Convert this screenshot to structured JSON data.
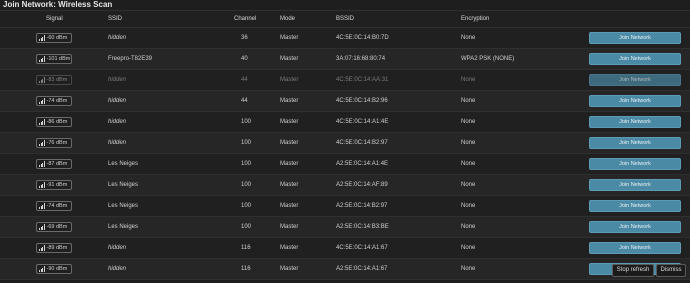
{
  "title": "Join Network: Wireless Scan",
  "columns": {
    "signal": "Signal",
    "ssid": "SSID",
    "channel": "Channel",
    "mode": "Mode",
    "bssid": "BSSID",
    "encryption": "Encryption"
  },
  "rows": [
    {
      "signal": "-60 dBm",
      "ssid": "hidden",
      "ssid_hidden": true,
      "channel": "36",
      "mode": "Master",
      "bssid": "4C:5E:0C:14:B0:7D",
      "encryption": "None",
      "join": "Join Network",
      "dimmed": false
    },
    {
      "signal": "-101 dBm",
      "ssid": "Freepro-T82E39",
      "ssid_hidden": false,
      "channel": "40",
      "mode": "Master",
      "bssid": "3A:07:16:68:80:74",
      "encryption": "WPA2 PSK (NONE)",
      "join": "Join Network",
      "dimmed": false
    },
    {
      "signal": "-83 dBm",
      "ssid": "hidden",
      "ssid_hidden": true,
      "channel": "44",
      "mode": "Master",
      "bssid": "4C:5E:0C:14:AA:31",
      "encryption": "None",
      "join": "Join Network",
      "dimmed": true
    },
    {
      "signal": "-74 dBm",
      "ssid": "hidden",
      "ssid_hidden": true,
      "channel": "44",
      "mode": "Master",
      "bssid": "4C:5E:0C:14:B2:96",
      "encryption": "None",
      "join": "Join Network",
      "dimmed": false
    },
    {
      "signal": "-86 dBm",
      "ssid": "hidden",
      "ssid_hidden": true,
      "channel": "100",
      "mode": "Master",
      "bssid": "4C:5E:0C:14:A1:4E",
      "encryption": "None",
      "join": "Join Network",
      "dimmed": false
    },
    {
      "signal": "-76 dBm",
      "ssid": "hidden",
      "ssid_hidden": true,
      "channel": "100",
      "mode": "Master",
      "bssid": "4C:5E:0C:14:B2:97",
      "encryption": "None",
      "join": "Join Network",
      "dimmed": false
    },
    {
      "signal": "-87 dBm",
      "ssid": "Les Neiges",
      "ssid_hidden": false,
      "channel": "100",
      "mode": "Master",
      "bssid": "A2:5E:0C:14:A1:4E",
      "encryption": "None",
      "join": "Join Network",
      "dimmed": false
    },
    {
      "signal": "-91 dBm",
      "ssid": "Les Neiges",
      "ssid_hidden": false,
      "channel": "100",
      "mode": "Master",
      "bssid": "A2:5E:0C:14:AF:89",
      "encryption": "None",
      "join": "Join Network",
      "dimmed": false
    },
    {
      "signal": "-74 dBm",
      "ssid": "Les Neiges",
      "ssid_hidden": false,
      "channel": "100",
      "mode": "Master",
      "bssid": "A2:5E:0C:14:B2:97",
      "encryption": "None",
      "join": "Join Network",
      "dimmed": false
    },
    {
      "signal": "-69 dBm",
      "ssid": "Les Neiges",
      "ssid_hidden": false,
      "channel": "100",
      "mode": "Master",
      "bssid": "A2:5E:0C:14:B3:BE",
      "encryption": "None",
      "join": "Join Network",
      "dimmed": false
    },
    {
      "signal": "-89 dBm",
      "ssid": "hidden",
      "ssid_hidden": true,
      "channel": "116",
      "mode": "Master",
      "bssid": "4C:5E:0C:14:A1:67",
      "encryption": "None",
      "join": "Join Network",
      "dimmed": false
    },
    {
      "signal": "-90 dBm",
      "ssid": "hidden",
      "ssid_hidden": true,
      "channel": "116",
      "mode": "Master",
      "bssid": "A2:5E:0C:14:A1:67",
      "encryption": "None",
      "join": "Join Network",
      "dimmed": false
    }
  ],
  "footer": {
    "stop_refresh": "Stop refresh",
    "dismiss": "Dismiss"
  },
  "icons": {
    "signal": "signal-strength-icon"
  },
  "colors": {
    "background": "#1e1e1e",
    "join_button": "#4b8aa5",
    "text": "#cfcfcf"
  }
}
